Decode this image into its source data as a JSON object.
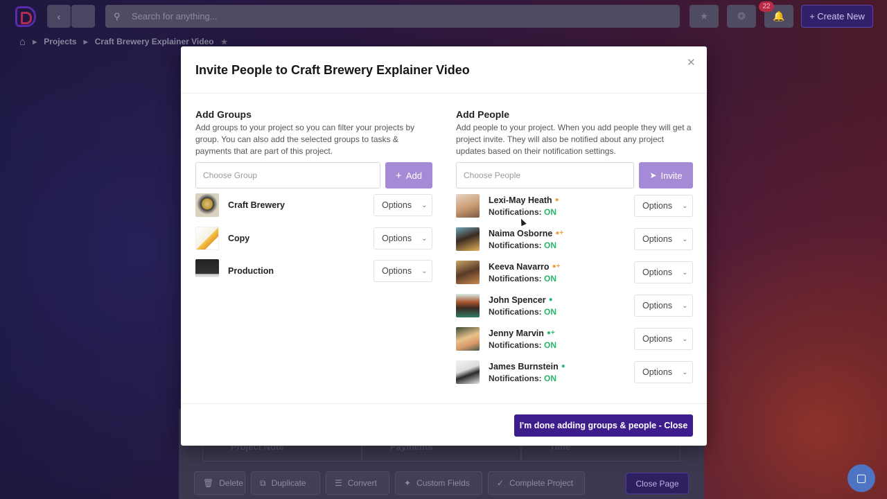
{
  "topbar": {
    "search_placeholder": "Search for anything...",
    "notification_count": "22",
    "create_new_label": "+ Create New"
  },
  "breadcrumb": {
    "projects": "Projects",
    "current": "Craft Brewery Explainer Video"
  },
  "underpage": {
    "tabs": [
      "Project Note",
      "Payments",
      "Time"
    ],
    "actions": {
      "delete": "Delete",
      "duplicate": "Duplicate",
      "convert": "Convert",
      "custom_fields": "Custom Fields",
      "complete_project": "Complete Project",
      "close_page": "Close Page"
    }
  },
  "modal": {
    "title": "Invite People to Craft Brewery Explainer Video",
    "groups": {
      "heading": "Add Groups",
      "description": "Add groups to your project so you can filter your projects by group. You can also add the selected groups to tasks & payments that are part of this project.",
      "select_placeholder": "Choose Group",
      "add_label": "Add",
      "items": [
        {
          "name": "Craft Brewery",
          "options": "Options"
        },
        {
          "name": "Copy",
          "options": "Options"
        },
        {
          "name": "Production",
          "options": "Options"
        }
      ]
    },
    "people": {
      "heading": "Add People",
      "description": "Add people to your project. When you add people they will get a project invite. They will also be notified about any project updates based on their notification settings.",
      "select_placeholder": "Choose People",
      "invite_label": "Invite",
      "notif_label": "Notifications:",
      "items": [
        {
          "name": "Lexi-May Heath",
          "status": "ON",
          "options": "Options",
          "role_color": "#f0a23a"
        },
        {
          "name": "Naima Osborne",
          "status": "ON",
          "options": "Options",
          "role_color": "#f0a23a"
        },
        {
          "name": "Keeva Navarro",
          "status": "ON",
          "options": "Options",
          "role_color": "#f0a23a"
        },
        {
          "name": "John Spencer",
          "status": "ON",
          "options": "Options",
          "role_color": "#2eb872"
        },
        {
          "name": "Jenny Marvin",
          "status": "ON",
          "options": "Options",
          "role_color": "#2eb872"
        },
        {
          "name": "James Burnstein",
          "status": "ON",
          "options": "Options",
          "role_color": "#2eb872"
        }
      ]
    },
    "done_label": "I'm done adding groups & people - Close"
  }
}
